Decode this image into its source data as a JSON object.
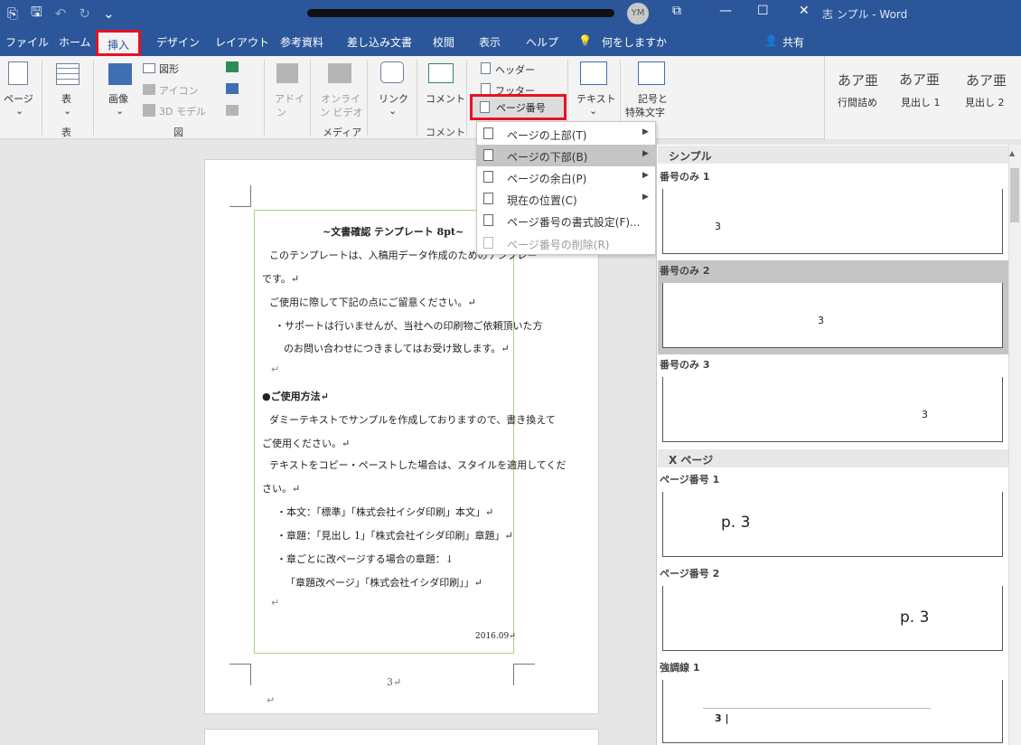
{
  "titlebar": {
    "title_suffix": "志 ンプル  -  Word",
    "avatar": "YM",
    "minimize": "—",
    "restore": "☐",
    "close": "✕",
    "ribbon_display": "⧉"
  },
  "tabs": {
    "file": "ファイル",
    "home": "ホーム",
    "insert": "挿入",
    "design": "デザイン",
    "layout": "レイアウト",
    "references": "参考資料",
    "mailings": "差し込み文書",
    "review": "校閲",
    "view": "表示",
    "help": "ヘルプ",
    "tell_me": "何をしますか",
    "share": "共有"
  },
  "ribbon": {
    "pages": "ページ",
    "table": "表",
    "table_group": "表",
    "pictures": "画像",
    "shapes": "図形",
    "icons": "アイコン",
    "models3d": "3D モデル",
    "illustrations_group": "図",
    "addins": "アドイ",
    "addins2": "ン",
    "online_video": "オンライ",
    "online_video2": "ン ビデオ",
    "media_group": "メディア",
    "links": "リンク",
    "comment": "コメント",
    "comment_group": "コメント",
    "header": "ヘッダー",
    "footer": "フッター",
    "page_number": "ページ番号",
    "text": "テキスト",
    "symbols": "記号と",
    "symbols2": "特殊文字",
    "chevron": "⌄"
  },
  "styles": {
    "sample1": "あア亜",
    "name1": "行間詰め",
    "sample2": "あア亜",
    "name2": "見出し 1",
    "sample3": "あア亜",
    "name3": "見出し 2"
  },
  "menu": {
    "items": [
      {
        "label": "ページの上部(T)"
      },
      {
        "label": "ページの下部(B)"
      },
      {
        "label": "ページの余白(P)"
      },
      {
        "label": "現在の位置(C)"
      },
      {
        "label": "ページ番号の書式設定(F)..."
      },
      {
        "label": "ページ番号の削除(R)"
      }
    ]
  },
  "gallery": {
    "sections": [
      "シンプル",
      "X ページ"
    ],
    "items": [
      {
        "name": "番号のみ 1",
        "number": "3"
      },
      {
        "name": "番号のみ 2",
        "number": "3"
      },
      {
        "name": "番号のみ 3",
        "number": "3"
      },
      {
        "name": "ページ番号 1",
        "number": "p. 3"
      },
      {
        "name": "ページ番号 2",
        "number": "p. 3"
      },
      {
        "name": "強調線 1",
        "number": "3 |"
      }
    ]
  },
  "document": {
    "lines": [
      "~文書確認 テンプレート 8pt~",
      "このテンプレートは、入稿用データ作成のためのテンプレー",
      "です。↵",
      "ご使用に際して下記の点にご留意ください。↵",
      "・サポートは行いませんが、当社への印刷物ご依頼頂いた方",
      "のお問い合わせにつきましてはお受け致します。↵",
      "↵",
      "●ご使用方法↵",
      "ダミーテキストでサンプルを作成しておりますので、書き換えて",
      "ご使用ください。↵",
      "テキストをコピー・ペーストした場合は、スタイルを適用してくだ",
      "さい。↵",
      "・本文：「標準」「株式会社イシダ印刷」本文」↵",
      "・章題：「見出し 1」「株式会社イシダ印刷」章題」↵",
      "・章ごとに改ページする場合の章題：↓",
      "「章題改ページ」「株式会社イシダ印刷」」↵",
      "↵",
      "2016.09↵"
    ],
    "footer_number": "3↵",
    "below_mark": "↵"
  },
  "icons": {
    "autosave": "⎘",
    "save": "🖫",
    "undo": "↶",
    "redo": "↻",
    "customize": "⌄",
    "lightbulb": "💡",
    "person": "👤",
    "arrow_right": "▶"
  }
}
